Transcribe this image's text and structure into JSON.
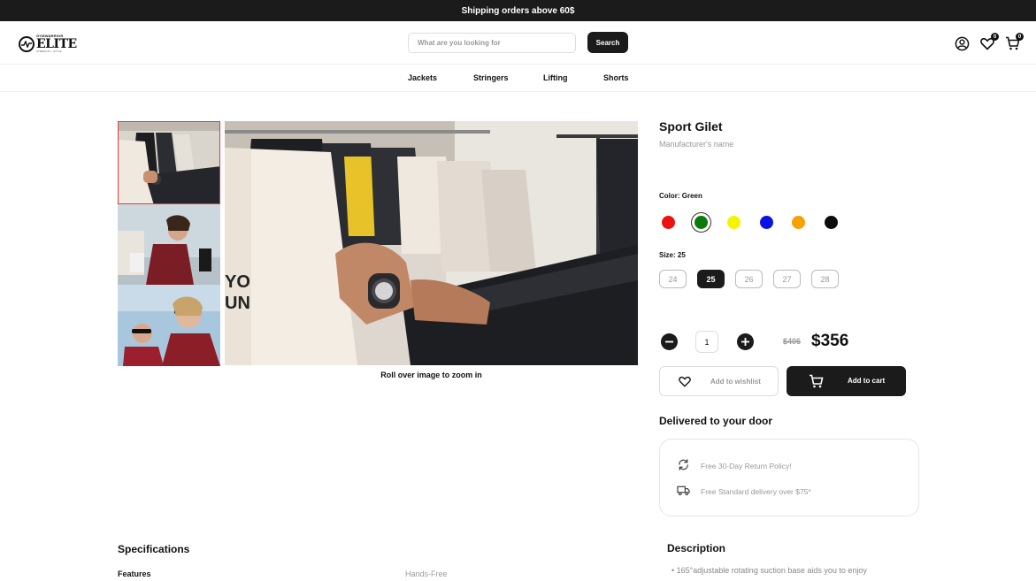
{
  "topbar": {
    "text": "Shipping orders above 60$"
  },
  "logo": {
    "small": "GYMWARRIOR",
    "big": "ELITE",
    "tag": "STRENGTH · STYLE"
  },
  "search": {
    "placeholder": "What are you looking for",
    "button": "Search"
  },
  "header_icons": {
    "wishlist_count": "0",
    "cart_count": "0"
  },
  "nav": {
    "items": [
      "Jackets",
      "Stringers",
      "Lifting",
      "Shorts"
    ]
  },
  "gallery": {
    "zoom_hint": "Roll over image to zoom in"
  },
  "product": {
    "title": "Sport Gilet",
    "manufacturer": "Manufacturer's name",
    "color_label": "Color: Green",
    "colors": [
      "#ee1111",
      "#0a7a0a",
      "#f6f300",
      "#0a12e6",
      "#f6a200",
      "#0c0c0c"
    ],
    "selected_color_index": 1,
    "size_label": "Size: 25",
    "sizes": [
      "24",
      "25",
      "26",
      "27",
      "28"
    ],
    "selected_size": "25",
    "quantity": "1",
    "old_price": "$406",
    "price": "$356",
    "wishlist_label": "Add to wishlist",
    "cart_label": "Add to cart"
  },
  "delivery": {
    "title": "Delivered to your door",
    "return_text": "Free 30-Day Return Policy!",
    "shipping_text": "Free Standard delivery over $75*"
  },
  "specifications": {
    "title": "Specifications",
    "key": "Features",
    "value": "Hands-Free"
  },
  "description": {
    "title": "Description",
    "item": "165°adjustable rotating suction base aids you to enjoy"
  }
}
